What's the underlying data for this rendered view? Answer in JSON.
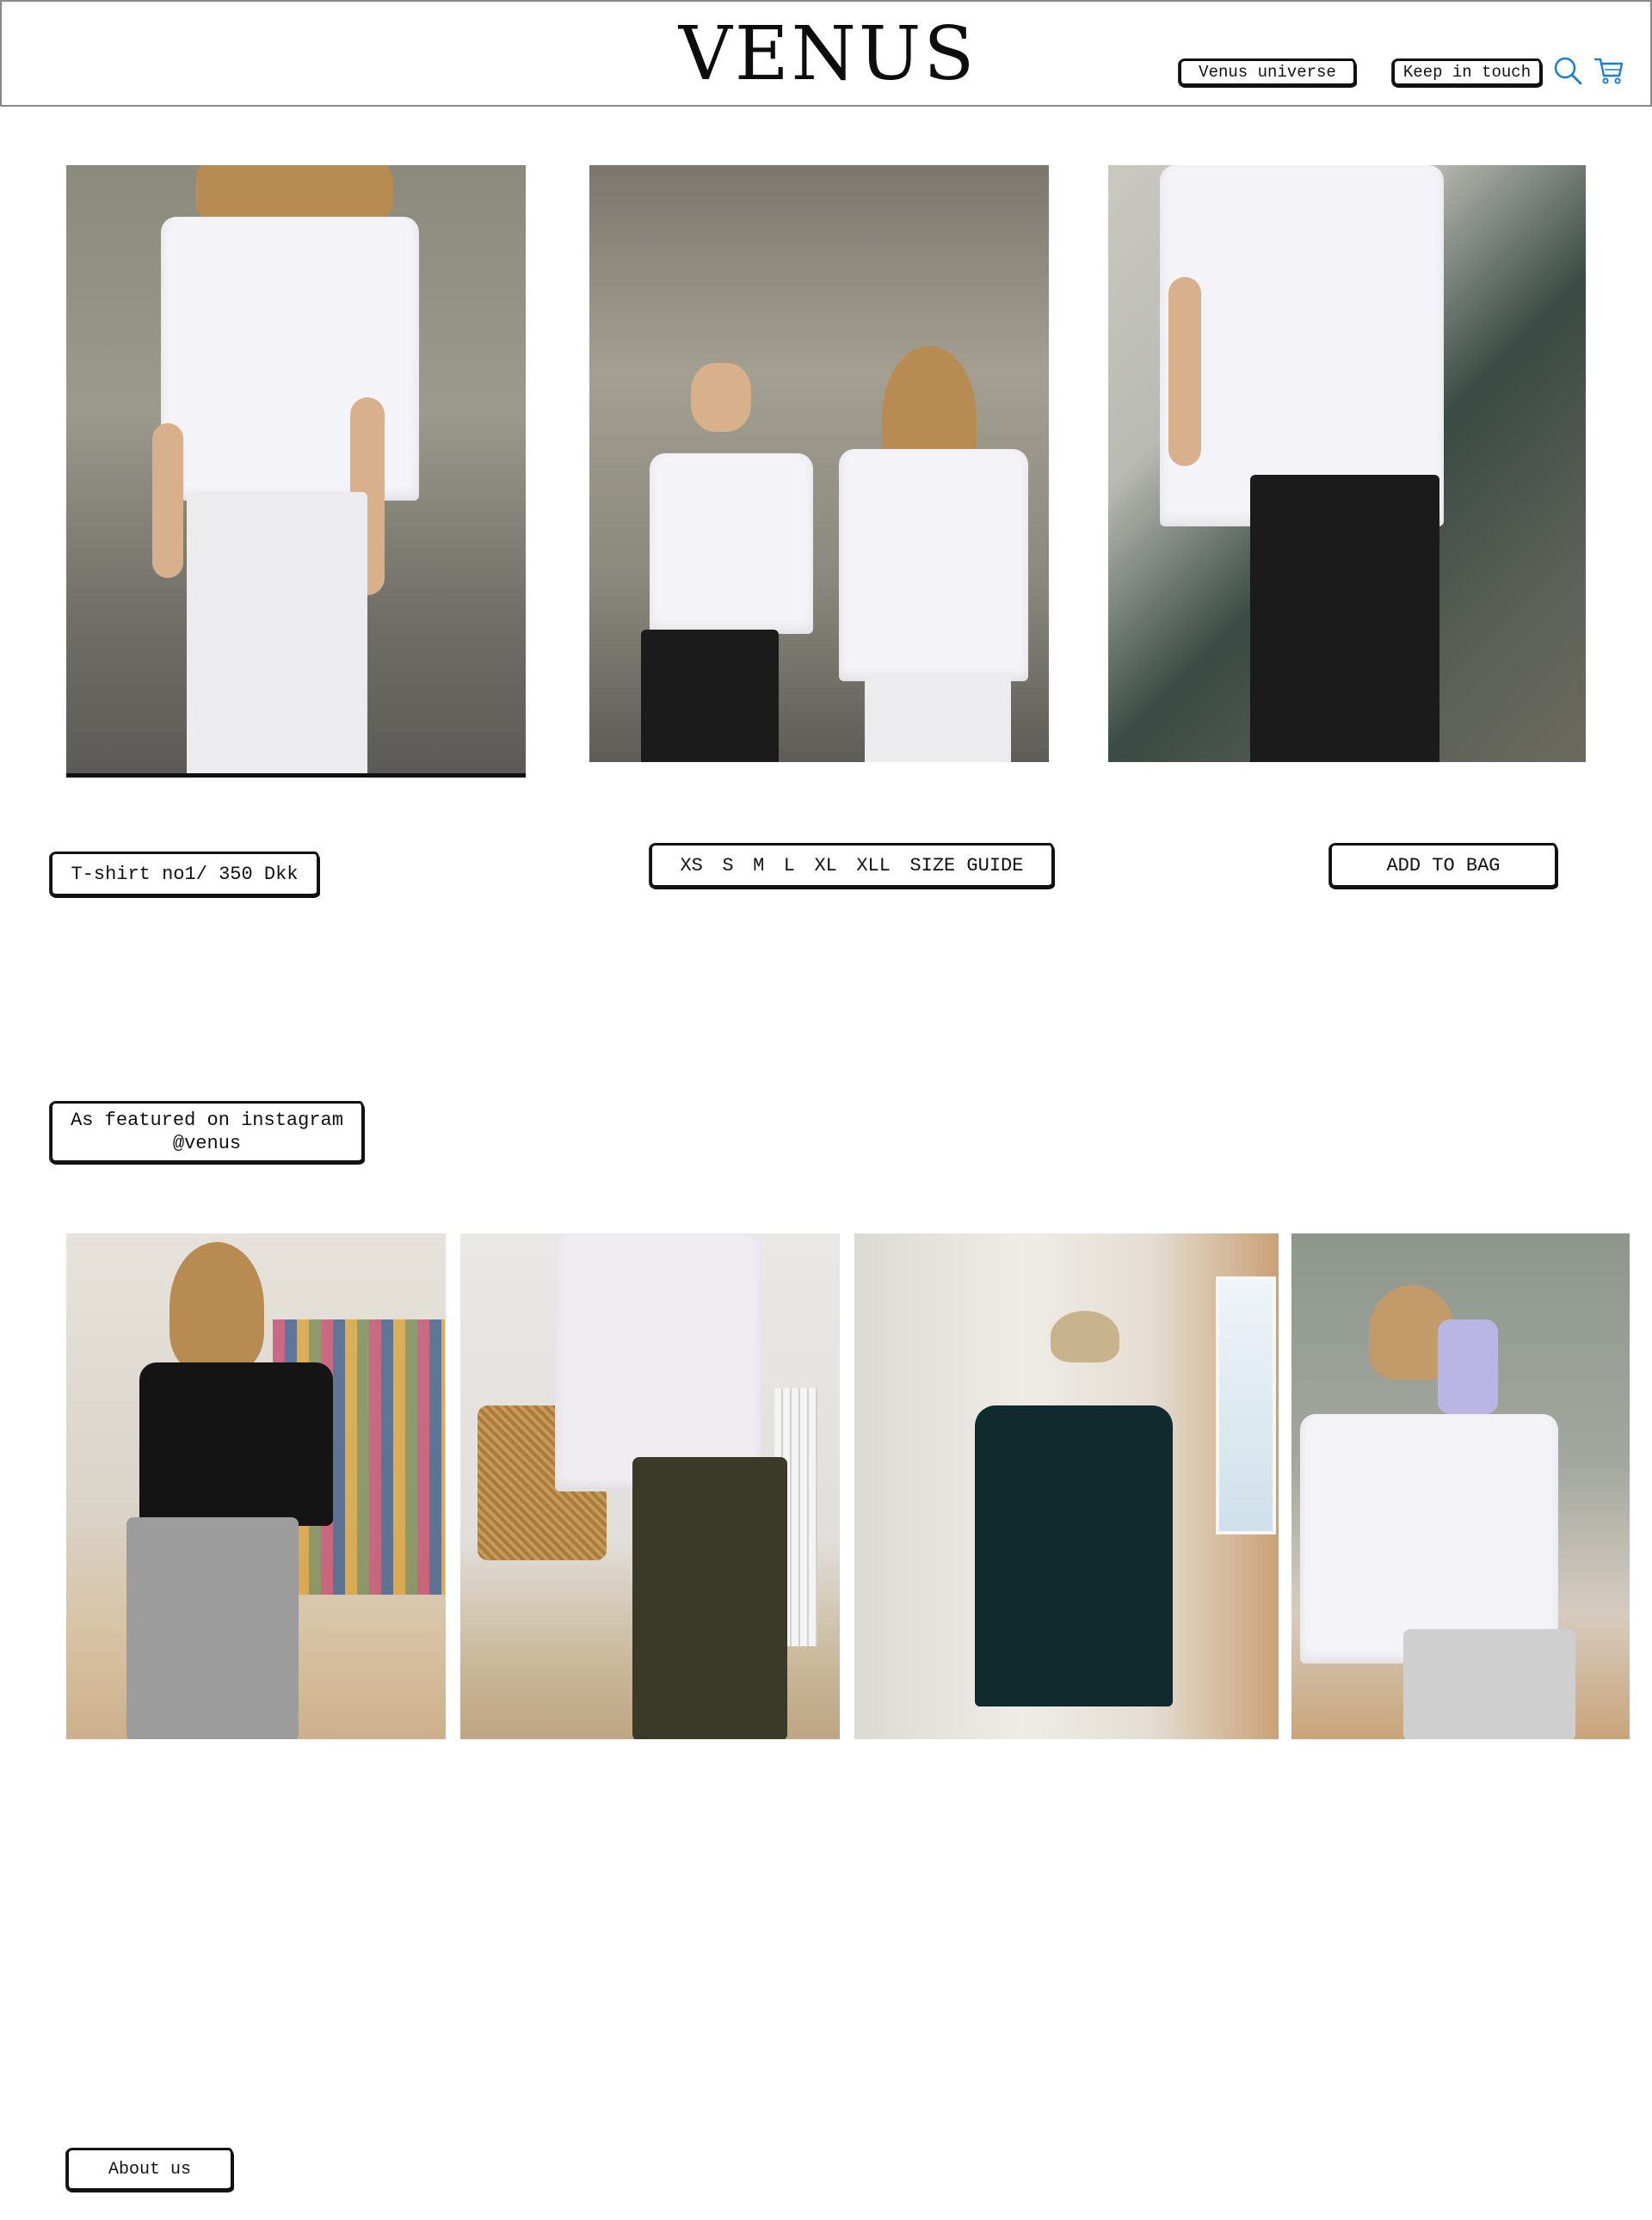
{
  "brand": {
    "logo": "VENUS"
  },
  "nav": {
    "venus_universe": "Venus universe",
    "keep_in_touch": "Keep in touch",
    "search_icon": "search-icon",
    "cart_icon": "cart-icon",
    "icon_color": "#1a7fd4"
  },
  "product": {
    "images": [
      {
        "alt": "White t-shirt with white jeans"
      },
      {
        "alt": "Two women wearing white t-shirts"
      },
      {
        "alt": "White t-shirt with black leather pants"
      }
    ],
    "price_label": "T-shirt no1/ 350 Dkk",
    "sizes": [
      "XS",
      "S",
      "M",
      "L",
      "XL",
      "XLL"
    ],
    "size_guide": "SIZE GUIDE",
    "add_to_bag": "ADD TO BAG"
  },
  "instagram": {
    "heading_line1": "As featured on instagram",
    "heading_line2": "@venus",
    "photos": [
      {
        "alt": "Mirror selfie in black t-shirt and grey sweatpants"
      },
      {
        "alt": "White t-shirt with dark jeans next to a cane chair"
      },
      {
        "alt": "Mirror selfie in oversized dark t-shirt"
      },
      {
        "alt": "Mirror selfie in white t-shirt and grey sweatpants"
      }
    ]
  },
  "footer": {
    "about_us": "About us"
  }
}
